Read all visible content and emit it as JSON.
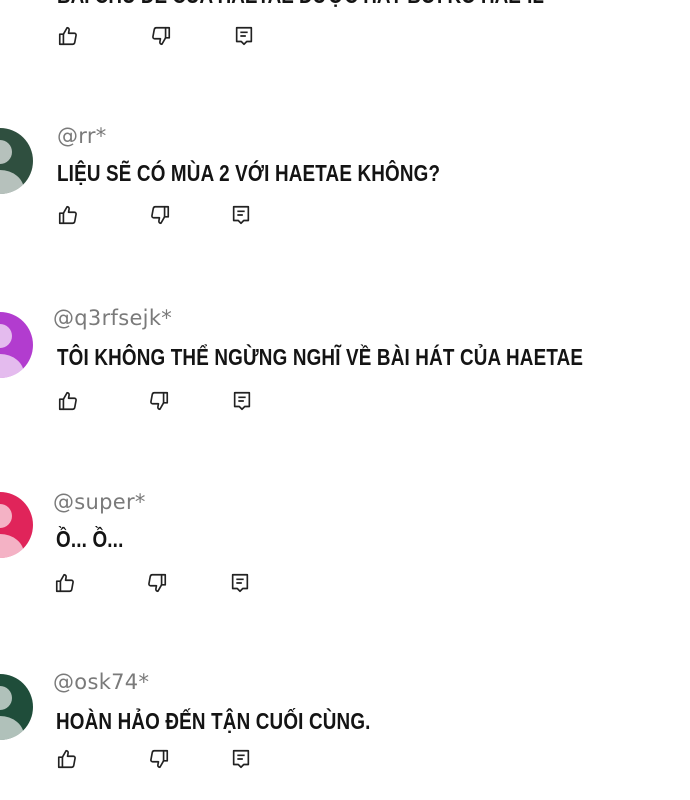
{
  "top_comment": {
    "text": "BÀI CHỦ ĐỀ CỦA HAETAE ĐƯỢC HÁT BỞI KO HAE-IL"
  },
  "comments": [
    {
      "handle": "@rr*",
      "text": "LIỆU SẼ CÓ MÙA 2 VỚI HAETAE KHÔNG?",
      "avatar_color": "#2f4f3f"
    },
    {
      "handle": "@q3rfsejk*",
      "text": "TÔI KHÔNG THỂ NGỪNG NGHĨ VỀ BÀI HÁT CỦA HAETAE",
      "avatar_color": "#b23ccf"
    },
    {
      "handle": "@super*",
      "text": "Ồ... Ồ...",
      "avatar_color": "#e0245a"
    },
    {
      "handle": "@osk74*",
      "text": "HOÀN HẢO ĐẾN TẬN CUỐI CÙNG.",
      "avatar_color": "#1f4d3a"
    }
  ],
  "icons": {
    "like": "thumbs-up-icon",
    "dislike": "thumbs-down-icon",
    "reply": "reply-comment-icon"
  }
}
